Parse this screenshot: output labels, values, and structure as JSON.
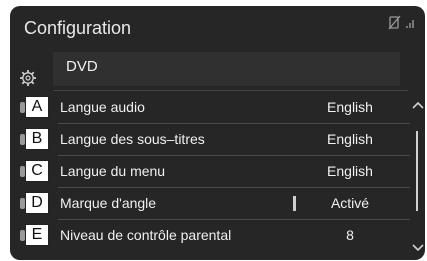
{
  "header": {
    "title": "Configuration"
  },
  "section": {
    "label": "DVD"
  },
  "rows": [
    {
      "letter": "A",
      "label": "Langue audio",
      "value": "English"
    },
    {
      "letter": "B",
      "label": "Langue des sous–titres",
      "value": "English"
    },
    {
      "letter": "C",
      "label": "Langue du menu",
      "value": "English"
    },
    {
      "letter": "D",
      "label": "Marque d'angle",
      "value": "Activé"
    },
    {
      "letter": "E",
      "label": "Niveau de contrôle parental",
      "value": "8"
    }
  ],
  "icons": {
    "settings": "settings-gear-icon",
    "status": "no-disc-signal-icon",
    "scroll_up": "chevron-up-icon",
    "scroll_down": "chevron-down-icon"
  },
  "colors": {
    "background": "#262626",
    "text": "#f0f0f0",
    "callout_box": "#ffffff"
  }
}
